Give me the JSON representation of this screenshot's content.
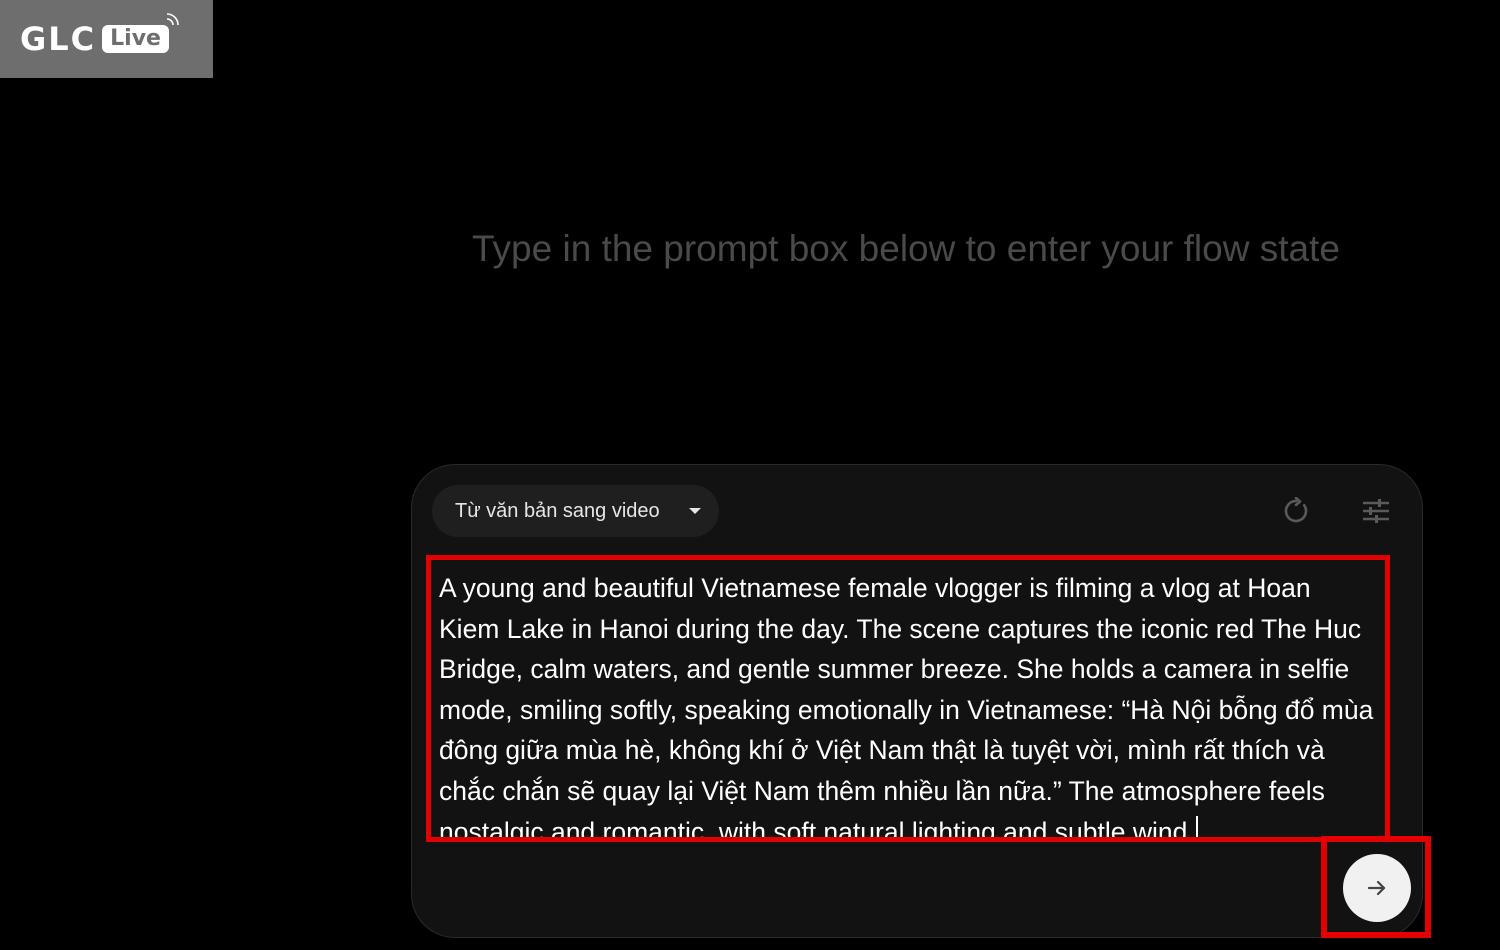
{
  "watermark": {
    "brand": "GLC",
    "badge": "Live"
  },
  "main": {
    "heading": "Type in the prompt box below to enter your flow state"
  },
  "prompt_box": {
    "mode_select": {
      "selected": "Từ văn bản sang video",
      "icon": "chevron-down-icon"
    },
    "refresh_icon": "refresh-icon",
    "settings_icon": "tune-settings-icon",
    "prompt_text": "A young and beautiful Vietnamese female vlogger is filming a vlog at Hoan Kiem Lake in Hanoi during the day. The scene captures the iconic red The Huc Bridge, calm waters, and gentle summer breeze. She holds a camera in selfie mode, smiling softly, speaking emotionally in Vietnamese: “Hà Nội bỗng đổ mùa đông giữa mùa hè, không khí ở Việt Nam thật là tuyệt vời, mình rất thích và chắc chắn sẽ quay lại Việt Nam thêm nhiều lần nữa.” The atmosphere feels nostalgic and romantic, with soft natural lighting and subtle wind.",
    "send_icon": "arrow-right-icon"
  },
  "colors": {
    "background": "#000000",
    "panel": "#121212",
    "highlight": "#e30000",
    "heading_text": "#4a4a4a"
  }
}
